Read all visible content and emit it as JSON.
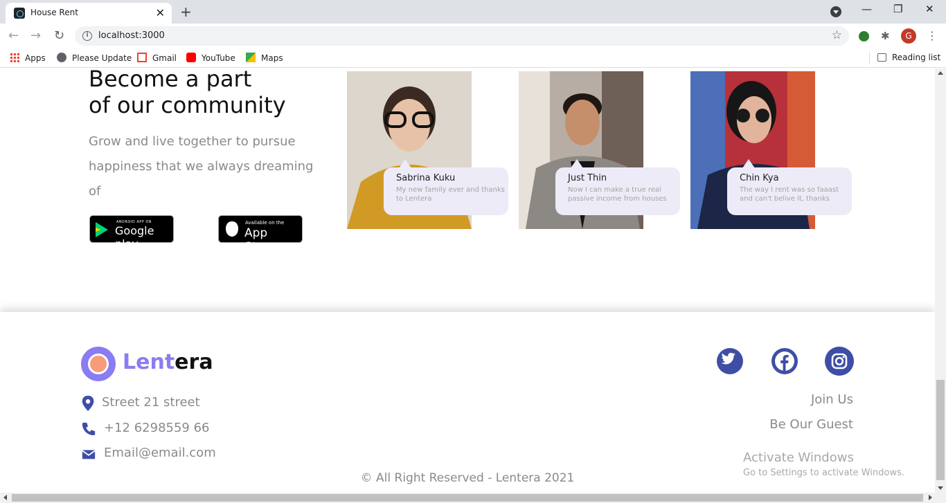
{
  "browser": {
    "tab_title": "House Rent",
    "url": "localhost:3000",
    "profile_initial": "G",
    "bookmarks": [
      "Apps",
      "Please Update",
      "Gmail",
      "YouTube",
      "Maps"
    ],
    "reading_list": "Reading list"
  },
  "community": {
    "title_line1": "Become a part",
    "title_line2": "of our community",
    "subtitle": "Grow and live together to pursue happiness that we always dreaming of",
    "google_play": {
      "small": "ANDROID APP ON",
      "big": "Google play"
    },
    "app_store": {
      "small": "Available on the",
      "big": "App Store"
    },
    "testimonials": [
      {
        "name": "Sabrina Kuku",
        "text": "My new family ever and thanks to Lentera"
      },
      {
        "name": "Just Thin",
        "text": "Now I can make a true real passive income from houses"
      },
      {
        "name": "Chin Kya",
        "text": "The way I rent was so faaast and can't belive it, thanks"
      }
    ]
  },
  "footer": {
    "brand_accent": "Lent",
    "brand_rest": "era",
    "address": "Street 21 street",
    "phone": "+12 6298559 66",
    "email": "Email@email.com",
    "links": [
      "Join Us",
      "Be Our Guest"
    ],
    "copyright": "© All Right Reserved - Lentera 2021"
  },
  "overlay": {
    "activate_title": "Activate Windows",
    "activate_sub": "Go to Settings to activate Windows."
  },
  "colors": {
    "brand": "#8a7cf2",
    "accent_dot": "#f79c7b",
    "social": "#3f4ea5",
    "bubble": "#ecebf7"
  }
}
